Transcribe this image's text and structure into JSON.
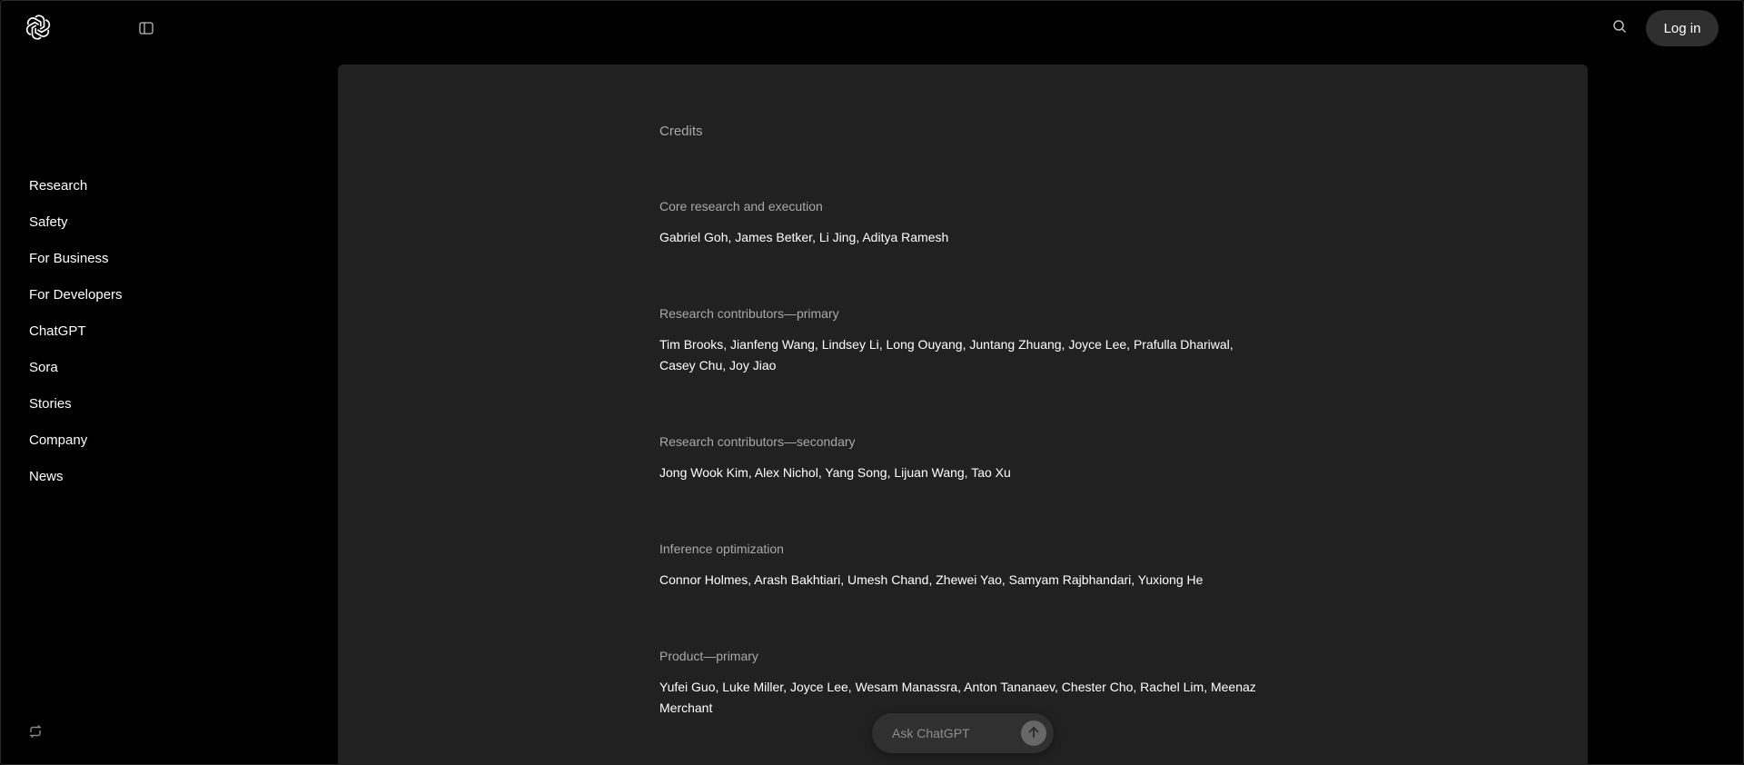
{
  "header": {
    "login_label": "Log in",
    "icons": {
      "logo": "openai-logo-icon",
      "sidebar_toggle": "sidebar-toggle-icon",
      "search": "search-icon"
    }
  },
  "sidebar": {
    "items": [
      {
        "label": "Research"
      },
      {
        "label": "Safety"
      },
      {
        "label": "For Business"
      },
      {
        "label": "For Developers"
      },
      {
        "label": "ChatGPT"
      },
      {
        "label": "Sora"
      },
      {
        "label": "Stories"
      },
      {
        "label": "Company"
      },
      {
        "label": "News"
      }
    ],
    "footer_icon": "theme-toggle-icon"
  },
  "main": {
    "title": "Credits",
    "sections": [
      {
        "heading": "Core research and execution",
        "names": "Gabriel Goh, James Betker, Li Jing, Aditya Ramesh"
      },
      {
        "heading": "Research contributors—primary",
        "names": "Tim Brooks, Jianfeng Wang, Lindsey Li, Long Ouyang, Juntang Zhuang, Joyce Lee, Prafulla Dhariwal, Casey Chu, Joy Jiao"
      },
      {
        "heading": "Research contributors—secondary",
        "names": "Jong Wook Kim, Alex Nichol, Yang Song, Lijuan Wang, Tao Xu"
      },
      {
        "heading": "Inference optimization",
        "names": "Connor Holmes, Arash Bakhtiari, Umesh Chand, Zhewei Yao, Samyam Rajbhandari, Yuxiong He"
      },
      {
        "heading": "Product—primary",
        "names": "Yufei Guo, Luke Miller, Joyce Lee, Wesam Manassra, Anton Tananaev, Chester Cho, Rachel Lim, Meenaz Merchant"
      }
    ]
  },
  "ask": {
    "placeholder": "Ask ChatGPT",
    "send_icon": "arrow-up-icon"
  },
  "colors": {
    "background": "#000000",
    "panel": "#212121",
    "muted_text": "#a9a9a9",
    "button": "#2f2f2f"
  }
}
